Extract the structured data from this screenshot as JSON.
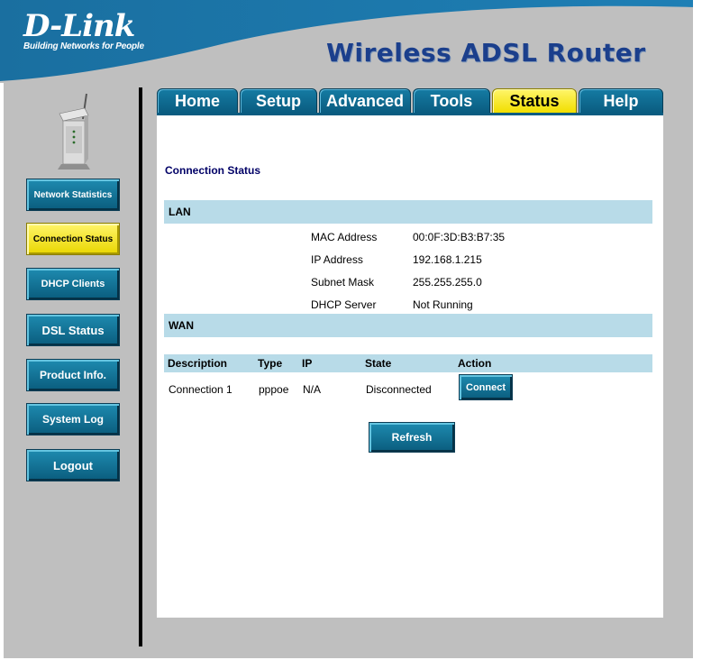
{
  "header": {
    "logo": "D-Link",
    "tagline": "Building Networks for People",
    "product": "Wireless ADSL Router"
  },
  "tabs": [
    {
      "label": "Home",
      "active": false
    },
    {
      "label": "Setup",
      "active": false
    },
    {
      "label": "Advanced",
      "active": false
    },
    {
      "label": "Tools",
      "active": false
    },
    {
      "label": "Status",
      "active": true
    },
    {
      "label": "Help",
      "active": false
    }
  ],
  "sidebar": {
    "items": [
      {
        "label": "Network Statistics",
        "active": false
      },
      {
        "label": "Connection Status",
        "active": true
      },
      {
        "label": "DHCP Clients",
        "active": false
      },
      {
        "label": "DSL Status",
        "active": false
      },
      {
        "label": "Product Info.",
        "active": false
      },
      {
        "label": "System Log",
        "active": false
      },
      {
        "label": "Logout",
        "active": false
      }
    ]
  },
  "main": {
    "title": "Connection Status",
    "lan": {
      "heading": "LAN",
      "rows": [
        {
          "label": "MAC Address",
          "value": "00:0F:3D:B3:B7:35"
        },
        {
          "label": "IP Address",
          "value": "192.168.1.215"
        },
        {
          "label": "Subnet Mask",
          "value": "255.255.255.0"
        },
        {
          "label": "DHCP Server",
          "value": "Not Running"
        }
      ]
    },
    "wan": {
      "heading": "WAN",
      "columns": [
        "Description",
        "Type",
        "IP",
        "State",
        "Action"
      ],
      "row": {
        "description": "Connection 1",
        "type": "pppoe",
        "ip": "N/A",
        "state": "Disconnected",
        "action_label": "Connect"
      }
    },
    "refresh_label": "Refresh"
  },
  "colors": {
    "brand_blue": "#0a5c80",
    "active_yellow": "#f1de00",
    "section_bar": "#b8dbe8",
    "frame_gray": "#bfbfbf"
  }
}
